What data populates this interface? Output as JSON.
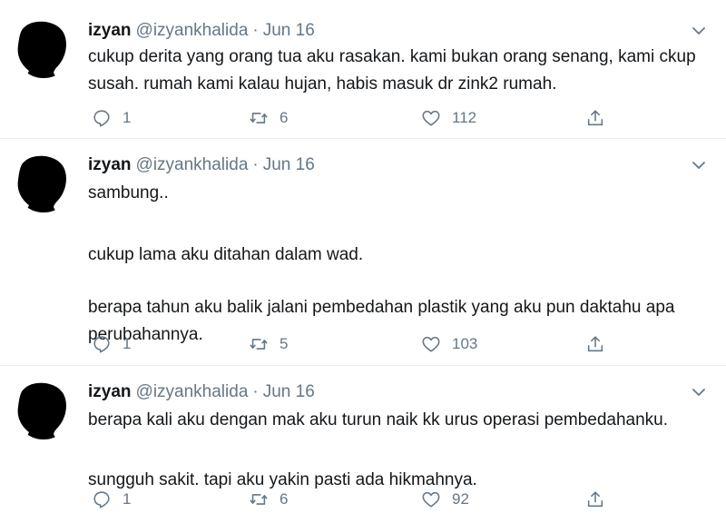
{
  "tweets": [
    {
      "name": "izyan",
      "handle": "@izyankhalida",
      "separator": "·",
      "date": "Jun 16",
      "paragraphs": [
        "cukup derita yang orang tua aku rasakan.  kami bukan orang senang,  kami ckup susah.  rumah kami kalau hujan, habis masuk dr zink2 rumah."
      ],
      "replies": "1",
      "retweets": "6",
      "likes": "112"
    },
    {
      "name": "izyan",
      "handle": "@izyankhalida",
      "separator": "·",
      "date": "Jun 16",
      "paragraphs": [
        "sambung..",
        "cukup lama aku ditahan dalam wad.",
        "berapa tahun aku balik jalani pembedahan plastik yang aku pun daktahu apa perubahannya."
      ],
      "replies": "1",
      "retweets": "5",
      "likes": "103"
    },
    {
      "name": "izyan",
      "handle": "@izyankhalida",
      "separator": "·",
      "date": "Jun 16",
      "paragraphs": [
        "berapa kali aku dengan mak aku turun naik kk urus operasi pembedahanku.",
        "sungguh sakit. tapi aku yakin pasti ada hikmahnya."
      ],
      "replies": "1",
      "retweets": "6",
      "likes": "92"
    }
  ],
  "icons": {
    "reply": "reply-icon",
    "retweet": "retweet-icon",
    "like": "heart-icon",
    "share": "share-icon",
    "caret": "chevron-down-icon",
    "avatar": "silhouette-avatar"
  },
  "colors": {
    "text": "#14171a",
    "muted": "#657786",
    "divider": "#e6ecf0"
  }
}
